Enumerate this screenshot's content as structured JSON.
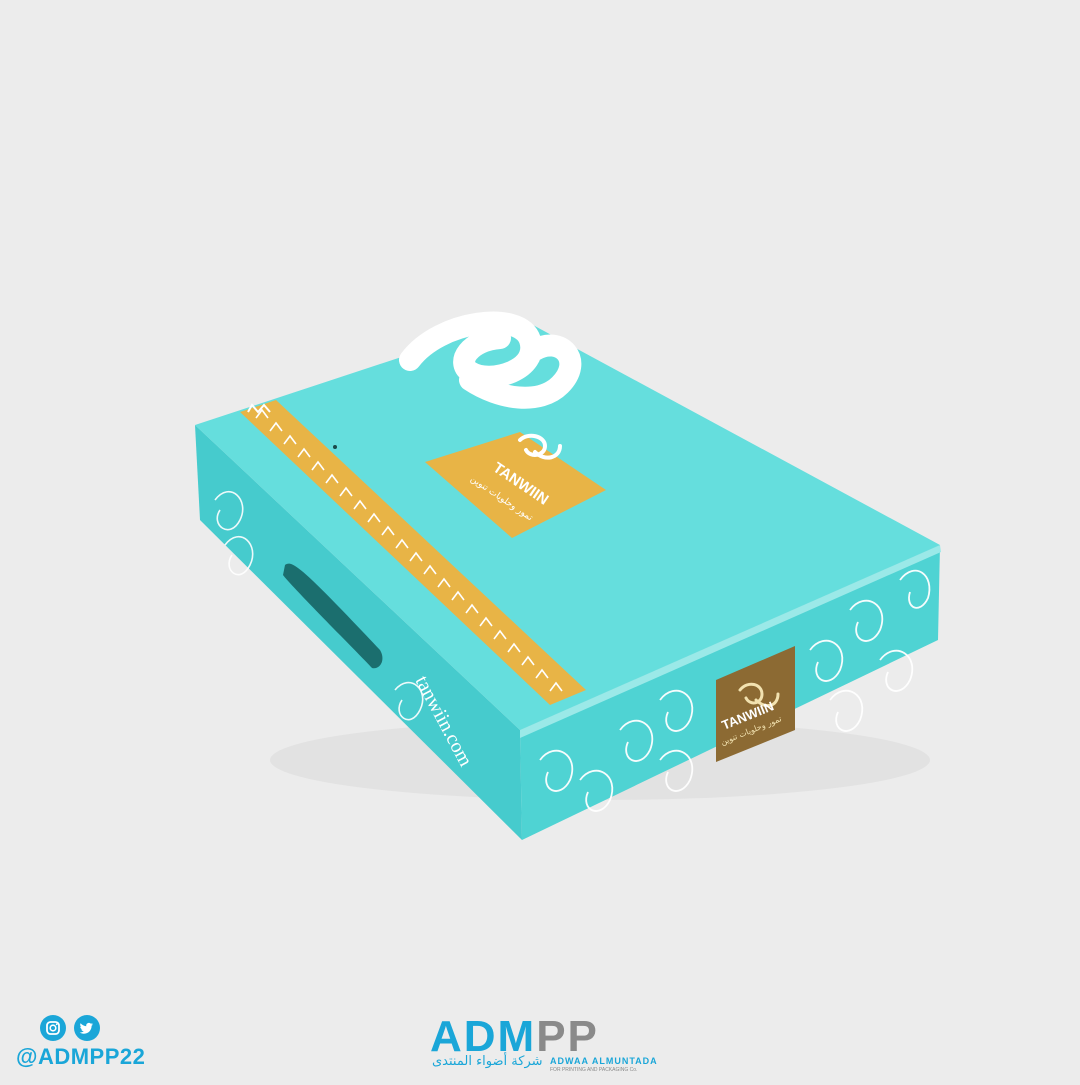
{
  "scene": {
    "subject": "teal packaging box",
    "colors": {
      "background": "#ececec",
      "box_top": "#62dddc",
      "box_side": "#49cfd0",
      "box_side_dark": "#39bdc0",
      "gold_band": "#e9b545",
      "label_brown": "#8c6a33",
      "brand_blue": "#1aa6d8"
    }
  },
  "box": {
    "logo_label": {
      "name": "TANWIIN",
      "arabic": "تمور وحلويات تنوين"
    },
    "side_label": {
      "name": "TANWIIN",
      "arabic": "تمور وحلويات تنوين"
    },
    "website": "tanwiin.com"
  },
  "footer": {
    "handle": "@ADMPP22",
    "icons": [
      "instagram-icon",
      "twitter-icon"
    ],
    "brand_adm": "ADM",
    "brand_pp": "PP",
    "brand_arabic": "شركة أضواء المنتدى",
    "brand_english": "ADWAA ALMUNTADA",
    "brand_tagline": "FOR PRINTING AND PACKAGING Co."
  }
}
